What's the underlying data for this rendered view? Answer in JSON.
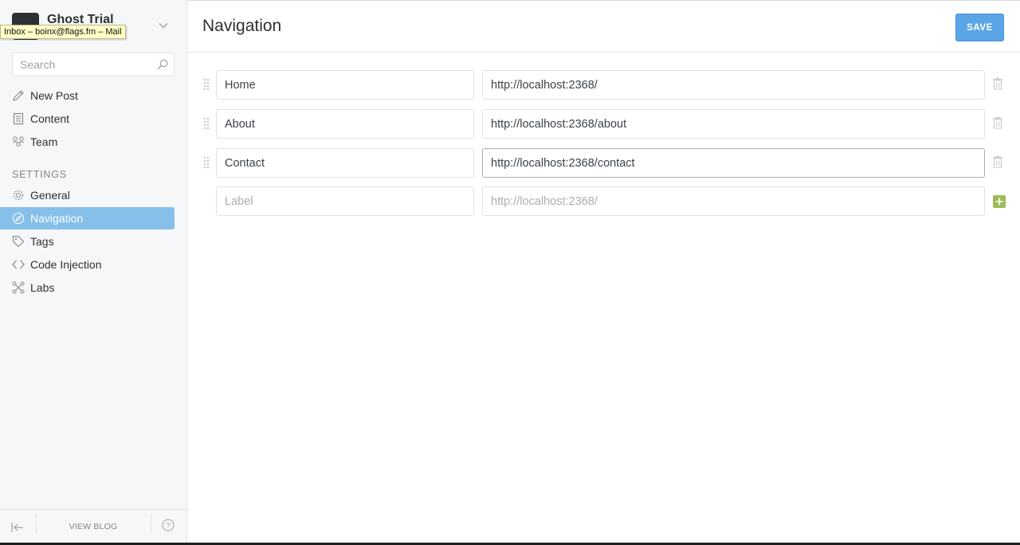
{
  "blog": {
    "title": "Ghost Trial"
  },
  "tooltip": {
    "text": "Inbox – boinx@flags.fm – Mail"
  },
  "search": {
    "placeholder": "Search"
  },
  "menu": {
    "new_post": "New Post",
    "content": "Content",
    "team": "Team"
  },
  "settings": {
    "section_label": "SETTINGS",
    "general": "General",
    "navigation": "Navigation",
    "tags": "Tags",
    "code_injection": "Code Injection",
    "labs": "Labs"
  },
  "footer": {
    "view_blog": "VIEW BLOG"
  },
  "header": {
    "title": "Navigation",
    "save_label": "SAVE"
  },
  "nav_items": [
    {
      "label": "Home",
      "url": "http://localhost:2368/"
    },
    {
      "label": "About",
      "url": "http://localhost:2368/about"
    },
    {
      "label": "Contact",
      "url": "http://localhost:2368/contact"
    }
  ],
  "new_item": {
    "label_placeholder": "Label",
    "url_placeholder": "http://localhost:2368/"
  },
  "colors": {
    "accent": "#5ba4e5",
    "active_nav": "#86bfea",
    "add_button": "#9fbb58"
  }
}
